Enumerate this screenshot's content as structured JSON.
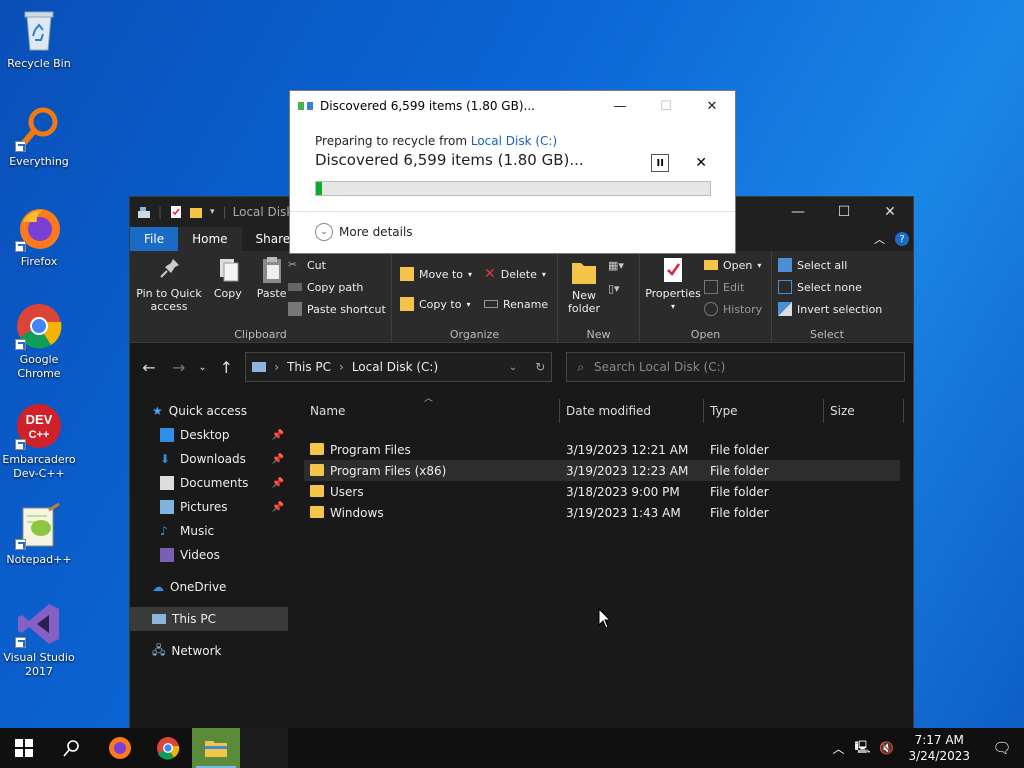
{
  "desktop": {
    "icons": [
      {
        "label": "Recycle Bin"
      },
      {
        "label": "Everything"
      },
      {
        "label": "Firefox"
      },
      {
        "label": "Google Chrome"
      },
      {
        "label": "Embarcadero Dev-C++"
      },
      {
        "label": "Notepad++"
      },
      {
        "label": "Visual Studio 2017"
      }
    ]
  },
  "dialog": {
    "title": "Discovered 6,599 items (1.80 GB)...",
    "preparing_prefix": "Preparing to recycle from ",
    "preparing_link": "Local Disk (C:)",
    "status": "Discovered 6,599 items (1.80 GB)...",
    "progress": 0.015,
    "more_details": "More details"
  },
  "explorer": {
    "title": "Local Disk",
    "tabs": [
      "File",
      "Home",
      "Share"
    ],
    "ribbon": {
      "clipboard": {
        "pin": "Pin to Quick access",
        "copy": "Copy",
        "paste": "Paste",
        "cut": "Cut",
        "copy_path": "Copy path",
        "paste_shortcut": "Paste shortcut",
        "group": "Clipboard"
      },
      "organize": {
        "move_to": "Move to",
        "copy_to": "Copy to",
        "delete": "Delete",
        "rename": "Rename",
        "group": "Organize"
      },
      "new": {
        "new_folder": "New folder",
        "group": "New"
      },
      "open": {
        "properties": "Properties",
        "open": "Open",
        "edit": "Edit",
        "history": "History",
        "group": "Open"
      },
      "select": {
        "select_all": "Select all",
        "select_none": "Select none",
        "invert": "Invert selection",
        "group": "Select"
      }
    },
    "address": {
      "parts": [
        "This PC",
        "Local Disk (C:)"
      ]
    },
    "search": {
      "placeholder": "Search Local Disk (C:)"
    },
    "nav": {
      "quick_access": "Quick access",
      "items": [
        {
          "label": "Desktop",
          "pinned": true
        },
        {
          "label": "Downloads",
          "pinned": true
        },
        {
          "label": "Documents",
          "pinned": true
        },
        {
          "label": "Pictures",
          "pinned": true
        },
        {
          "label": "Music",
          "pinned": false
        },
        {
          "label": "Videos",
          "pinned": false
        }
      ],
      "onedrive": "OneDrive",
      "this_pc": "This PC",
      "network": "Network"
    },
    "columns": [
      "Name",
      "Date modified",
      "Type",
      "Size"
    ],
    "files": [
      {
        "name": "Program Files",
        "date": "3/19/2023 12:21 AM",
        "type": "File folder"
      },
      {
        "name": "Program Files (x86)",
        "date": "3/19/2023 12:23 AM",
        "type": "File folder"
      },
      {
        "name": "Users",
        "date": "3/18/2023 9:00 PM",
        "type": "File folder"
      },
      {
        "name": "Windows",
        "date": "3/19/2023 1:43 AM",
        "type": "File folder"
      }
    ]
  },
  "taskbar": {
    "time": "7:17 AM",
    "date": "3/24/2023"
  },
  "colors": {
    "accent": "#1a6bc4",
    "progress": "#06b025",
    "folder": "#f3c549"
  }
}
